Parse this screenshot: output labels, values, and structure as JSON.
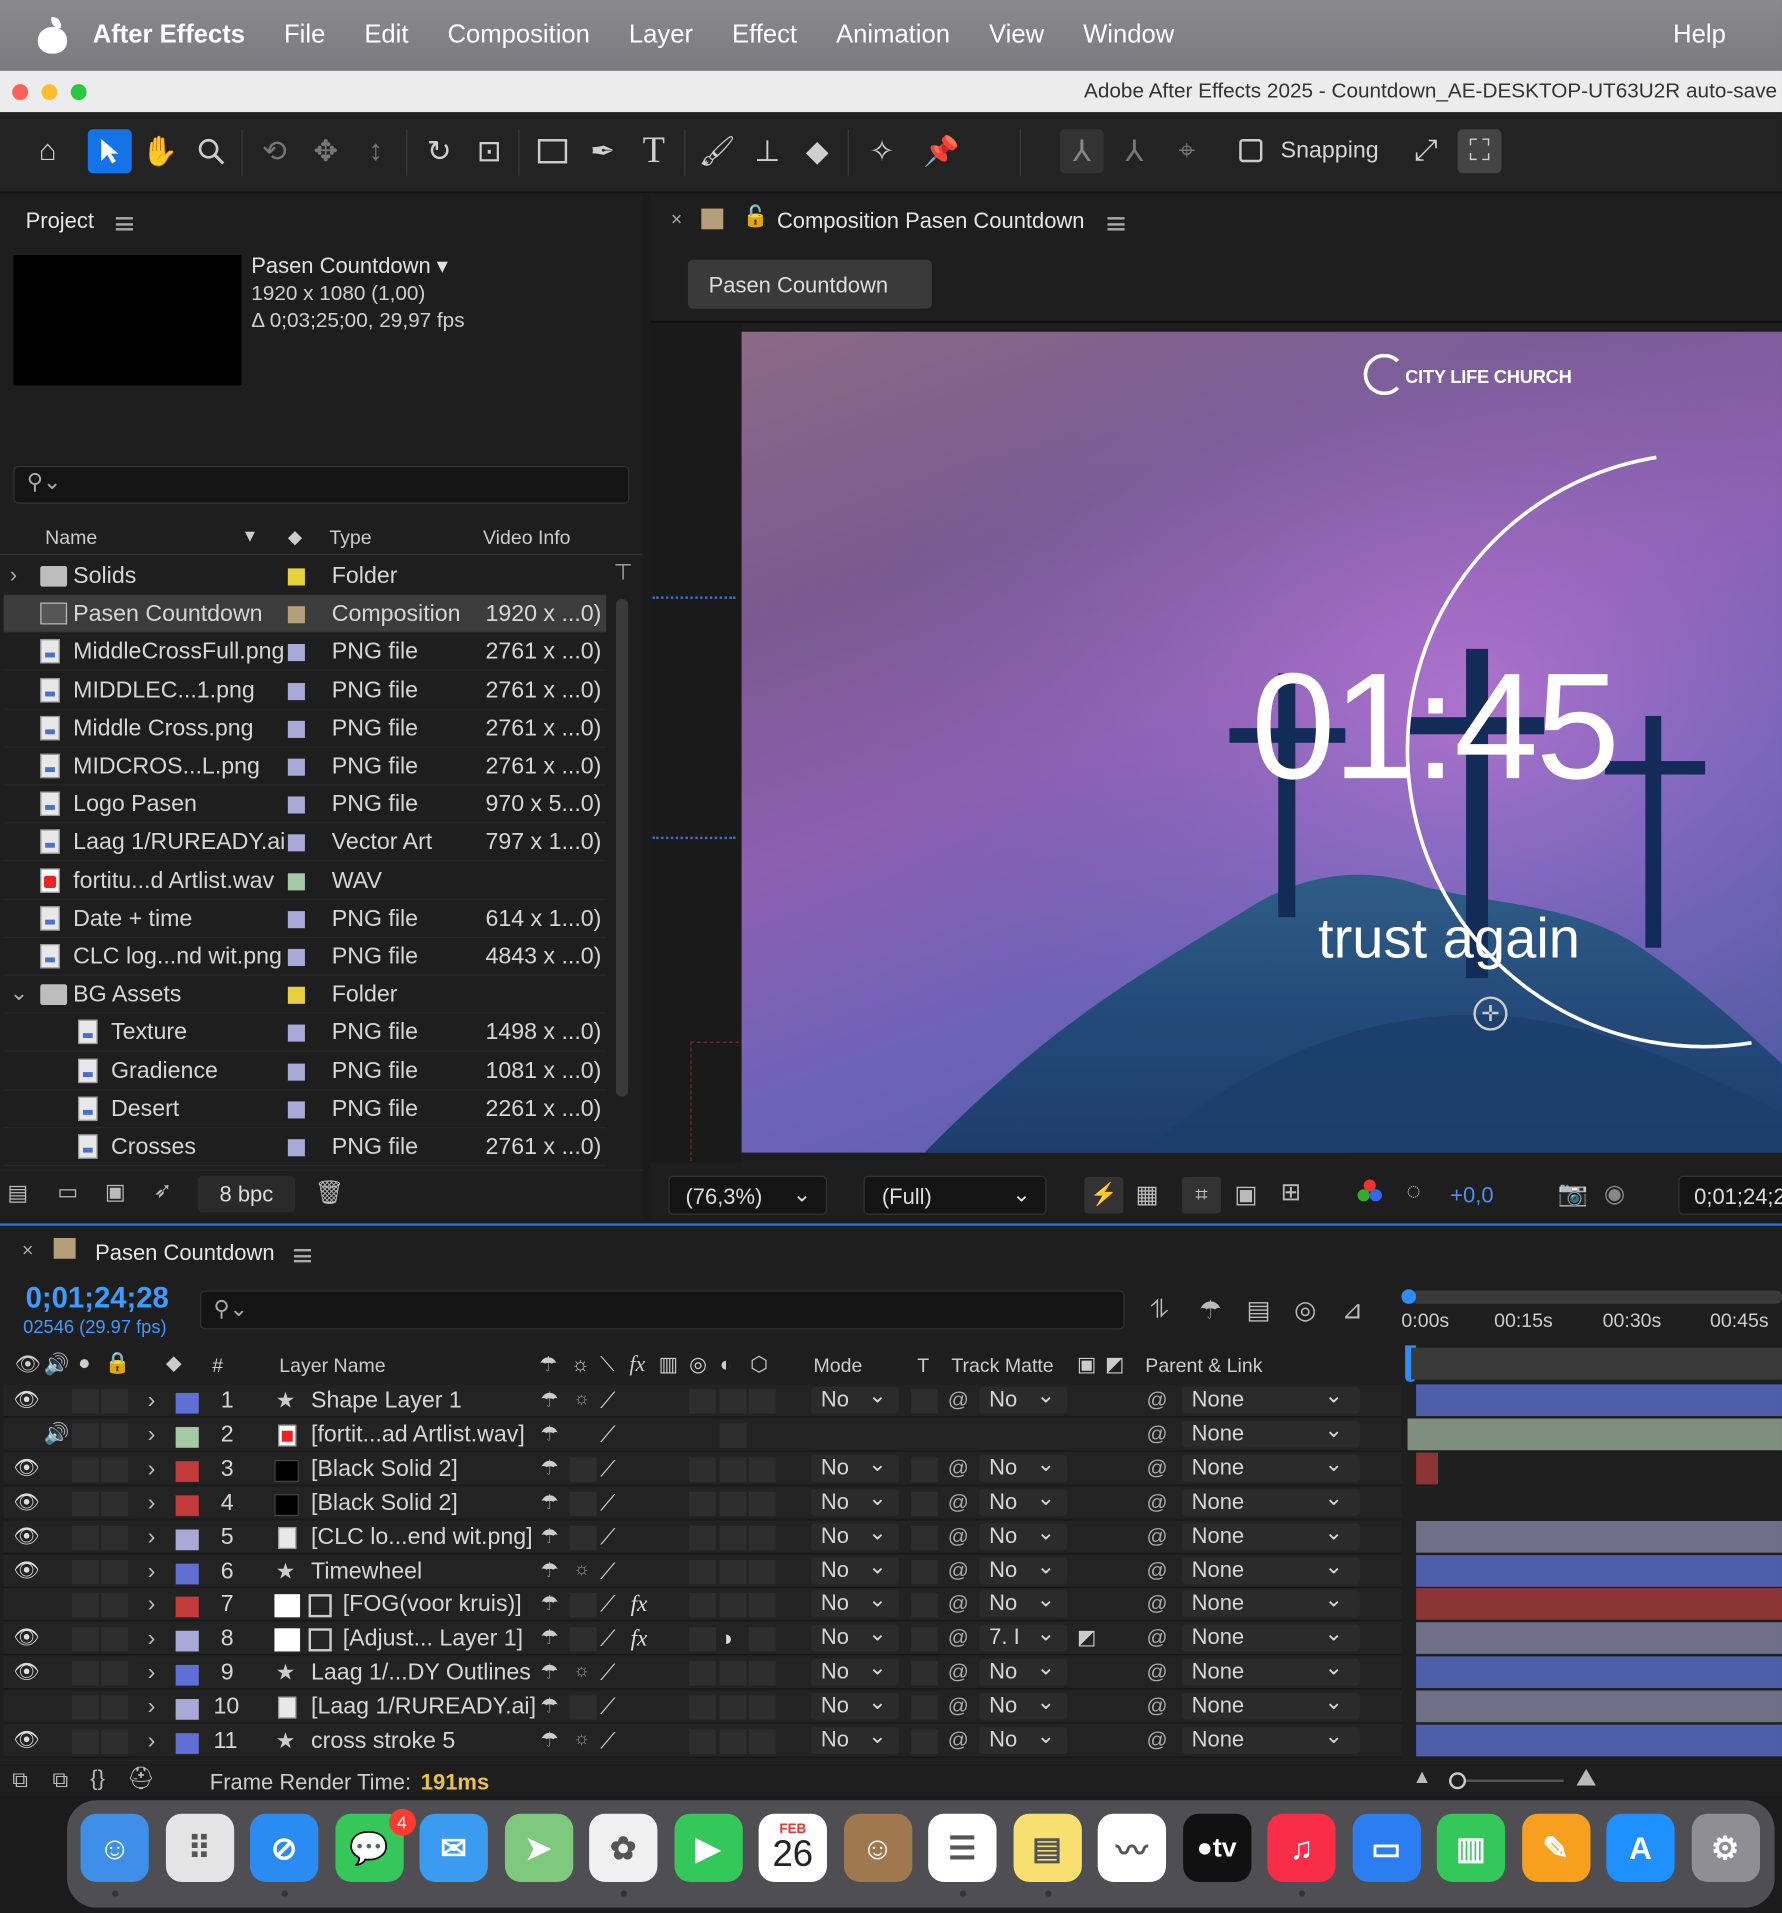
{
  "menubar": {
    "app": "After Effects",
    "items": [
      "File",
      "Edit",
      "Composition",
      "Layer",
      "Effect",
      "Animation",
      "View",
      "Window"
    ],
    "help": "Help"
  },
  "window": {
    "title": "Adobe After Effects 2025 - Countdown_AE-DESKTOP-UT63U2R auto-save"
  },
  "toolbar": {
    "snapping": "Snapping"
  },
  "project": {
    "title": "Project",
    "comp_name": "Pasen Countdown",
    "comp_size": "1920 x 1080 (1,00)",
    "comp_duration": "Δ 0;03;25;00, 29,97 fps",
    "headers": {
      "name": "Name",
      "type": "Type",
      "video_info": "Video Info"
    },
    "rows": [
      {
        "name": "Solids",
        "type": "Folder",
        "info": "",
        "icon": "folder-icon",
        "color": "#e8d03c",
        "indent": 0,
        "expander": "›"
      },
      {
        "name": "Pasen Countdown",
        "type": "Composition",
        "info": "1920 x ...0)",
        "icon": "composition-icon",
        "color": "#b59f7a",
        "indent": 0,
        "expander": "",
        "selected": true
      },
      {
        "name": "MiddleCrossFull.png",
        "type": "PNG file",
        "info": "2761 x ...0)",
        "icon": "png-file-icon",
        "color": "#a9a9d8",
        "indent": 0,
        "expander": ""
      },
      {
        "name": "MIDDLEC...1.png",
        "type": "PNG file",
        "info": "2761 x ...0)",
        "icon": "png-file-icon",
        "color": "#a9a9d8",
        "indent": 0,
        "expander": ""
      },
      {
        "name": "Middle Cross.png",
        "type": "PNG file",
        "info": "2761 x ...0)",
        "icon": "png-file-icon",
        "color": "#a9a9d8",
        "indent": 0,
        "expander": ""
      },
      {
        "name": "MIDCROS...L.png",
        "type": "PNG file",
        "info": "2761 x ...0)",
        "icon": "png-file-icon",
        "color": "#a9a9d8",
        "indent": 0,
        "expander": ""
      },
      {
        "name": "Logo  Pasen",
        "type": "PNG file",
        "info": "970 x 5...0)",
        "icon": "png-file-icon",
        "color": "#a9a9d8",
        "indent": 0,
        "expander": ""
      },
      {
        "name": "Laag 1/RUREADY.ai",
        "type": "Vector Art",
        "info": "797 x 1...0)",
        "icon": "png-file-icon",
        "color": "#a9a9d8",
        "indent": 0,
        "expander": ""
      },
      {
        "name": "fortitu...d Artlist.wav",
        "type": "WAV",
        "info": "",
        "icon": "wav-file-icon",
        "color": "#a5c8a5",
        "indent": 0,
        "expander": ""
      },
      {
        "name": "Date + time",
        "type": "PNG file",
        "info": "614 x 1...0)",
        "icon": "png-file-icon",
        "color": "#a9a9d8",
        "indent": 0,
        "expander": ""
      },
      {
        "name": "CLC log...nd wit.png",
        "type": "PNG file",
        "info": "4843 x ...0)",
        "icon": "png-file-icon",
        "color": "#a9a9d8",
        "indent": 0,
        "expander": ""
      },
      {
        "name": "BG Assets",
        "type": "Folder",
        "info": "",
        "icon": "folder-icon",
        "color": "#e8d03c",
        "indent": 0,
        "expander": "⌄"
      },
      {
        "name": "Texture",
        "type": "PNG file",
        "info": "1498 x ...0)",
        "icon": "png-file-icon",
        "color": "#a9a9d8",
        "indent": 1,
        "expander": ""
      },
      {
        "name": "Gradience",
        "type": "PNG file",
        "info": "1081 x ...0)",
        "icon": "png-file-icon",
        "color": "#a9a9d8",
        "indent": 1,
        "expander": ""
      },
      {
        "name": "Desert",
        "type": "PNG file",
        "info": "2261 x ...0)",
        "icon": "png-file-icon",
        "color": "#a9a9d8",
        "indent": 1,
        "expander": ""
      },
      {
        "name": "Crosses",
        "type": "PNG file",
        "info": "2761 x ...0)",
        "icon": "png-file-icon",
        "color": "#a9a9d8",
        "indent": 1,
        "expander": ""
      }
    ],
    "bpc": "8 bpc"
  },
  "composition": {
    "panel_title": "Composition Pasen Countdown",
    "tab": "Pasen Countdown",
    "logo_text": "CITY LIFE CHURCH",
    "countdown": "01:45",
    "tagline": "trust again",
    "zoom": "(76,3%)",
    "resolution": "(Full)",
    "exposure": "+0,0",
    "timecode": "0;01;24;2"
  },
  "timeline": {
    "tab": "Pasen Countdown",
    "timecode": "0;01;24;28",
    "frame_info": "02546 (29.97 fps)",
    "ruler": [
      "0:00s",
      "00:15s",
      "00:30s",
      "00:45s"
    ],
    "headers": {
      "num": "#",
      "layer_name": "Layer Name",
      "mode": "Mode",
      "t": "T",
      "track_matte": "Track Matte",
      "parent": "Parent & Link"
    },
    "layers": [
      {
        "num": "1",
        "name": "Shape Layer 1",
        "kind": "shape",
        "label": "#5f6fd6",
        "visible": true,
        "audio": false,
        "fx": false,
        "mode": "No",
        "matte": "No",
        "parent": "None",
        "bar": "#4e5ea8",
        "bar_from": 0.0
      },
      {
        "num": "2",
        "name": "[fortit...ad Artlist.wav]",
        "kind": "audio",
        "label": "#a5c8a5",
        "visible": false,
        "audio": true,
        "fx": false,
        "mode": "",
        "matte": "",
        "parent": "None",
        "bar": "#7f8f7f",
        "bar_from": 0.0
      },
      {
        "num": "3",
        "name": "[Black Solid 2]",
        "kind": "solid",
        "label": "#c23b3b",
        "visible": true,
        "audio": false,
        "fx": false,
        "mode": "No",
        "matte": "No",
        "parent": "None",
        "bar": "#8a3434",
        "bar_from": 0.0,
        "bar_short": true
      },
      {
        "num": "4",
        "name": "[Black Solid 2]",
        "kind": "solid",
        "label": "#c23b3b",
        "visible": true,
        "audio": false,
        "fx": false,
        "mode": "No",
        "matte": "No",
        "parent": "None",
        "bar": "",
        "bar_from": 0.0
      },
      {
        "num": "5",
        "name": "[CLC lo...end wit.png]",
        "kind": "footage",
        "label": "#a9a9d8",
        "visible": true,
        "audio": false,
        "fx": false,
        "mode": "No",
        "matte": "No",
        "parent": "None",
        "bar": "#6f6f88",
        "bar_from": 0.0
      },
      {
        "num": "6",
        "name": "Timewheel",
        "kind": "shape",
        "label": "#5f6fd6",
        "visible": true,
        "audio": false,
        "fx": false,
        "mode": "No",
        "matte": "No",
        "parent": "None",
        "bar": "#4e5ea8",
        "bar_from": 0.0
      },
      {
        "num": "7",
        "name": "[FOG(voor kruis)]",
        "kind": "white-solid",
        "label": "#c23b3b",
        "visible": false,
        "audio": false,
        "fx": true,
        "mode": "No",
        "matte": "No",
        "parent": "None",
        "bar": "#8a3434",
        "bar_from": 0.0
      },
      {
        "num": "8",
        "name": "[Adjust... Layer 1]",
        "kind": "white-solid",
        "label": "#a9a9d8",
        "visible": true,
        "audio": false,
        "fx": true,
        "mode": "No",
        "matte": "7. I",
        "parent": "None",
        "bar": "#6f6f88",
        "bar_from": 0.0
      },
      {
        "num": "9",
        "name": "Laag 1/...DY Outlines",
        "kind": "shape",
        "label": "#5f6fd6",
        "visible": true,
        "audio": false,
        "fx": false,
        "mode": "No",
        "matte": "No",
        "parent": "None",
        "bar": "#4e5ea8",
        "bar_from": 0.0
      },
      {
        "num": "10",
        "name": "[Laag 1/RUREADY.ai]",
        "kind": "footage",
        "label": "#a9a9d8",
        "visible": false,
        "audio": false,
        "fx": false,
        "mode": "No",
        "matte": "No",
        "parent": "None",
        "bar": "#6f6f88",
        "bar_from": 0.0
      },
      {
        "num": "11",
        "name": "cross stroke 5",
        "kind": "shape",
        "label": "#5f6fd6",
        "visible": true,
        "audio": false,
        "fx": false,
        "mode": "No",
        "matte": "No",
        "parent": "None",
        "bar": "#4e5ea8",
        "bar_from": 0.0
      }
    ],
    "render_label": "Frame Render Time:",
    "render_value": "191ms"
  },
  "dock": {
    "calendar_month": "FEB",
    "calendar_day": "26",
    "messages_badge": "4",
    "tv_label": "tv",
    "apps": [
      "finder-icon",
      "launchpad-icon",
      "safari-icon",
      "messages-icon",
      "mail-icon",
      "maps-icon",
      "photos-icon",
      "facetime-icon",
      "calendar-icon",
      "contacts-icon",
      "reminders-icon",
      "notes-icon",
      "freeform-icon",
      "apple-tv-icon",
      "music-icon",
      "keynote-icon",
      "numbers-icon",
      "pages-icon",
      "app-store-icon",
      "system-settings-icon"
    ]
  },
  "colors": {
    "accent": "#1473e6",
    "timecode": "#3e9bff",
    "render_time": "#e8c34a"
  }
}
